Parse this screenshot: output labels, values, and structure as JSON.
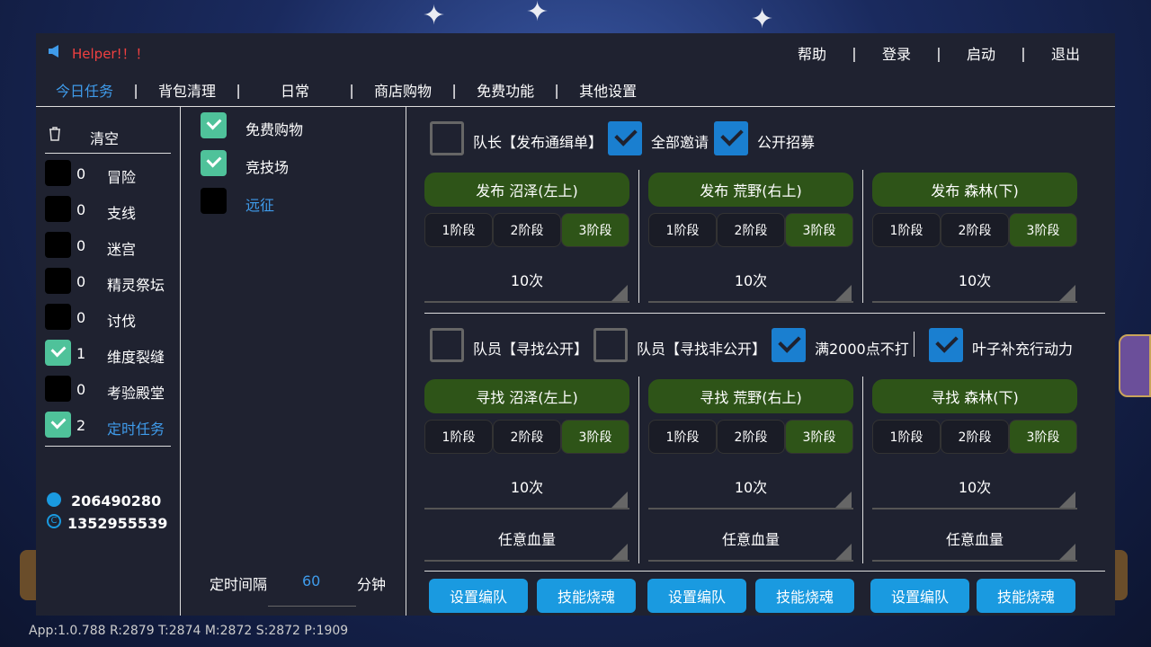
{
  "app": {
    "title": "Helper!！！"
  },
  "topmenu": [
    {
      "label": "帮助"
    },
    {
      "label": "登录"
    },
    {
      "label": "启动"
    },
    {
      "label": "退出"
    }
  ],
  "separator": "|",
  "tabs": [
    {
      "label": "今日任务",
      "active": true
    },
    {
      "label": "背包清理"
    },
    {
      "label": "日常"
    },
    {
      "label": "商店购物"
    },
    {
      "label": "免费功能"
    },
    {
      "label": "其他设置"
    }
  ],
  "left": {
    "clear_label": "清空",
    "items": [
      {
        "count": "0",
        "label": "冒险",
        "checked": false
      },
      {
        "count": "0",
        "label": "支线",
        "checked": false
      },
      {
        "count": "0",
        "label": "迷宫",
        "checked": false
      },
      {
        "count": "0",
        "label": "精灵祭坛",
        "checked": false
      },
      {
        "count": "0",
        "label": "讨伐",
        "checked": false
      },
      {
        "count": "1",
        "label": "维度裂缝",
        "checked": true
      },
      {
        "count": "0",
        "label": "考验殿堂",
        "checked": false
      },
      {
        "count": "2",
        "label": "定时任务",
        "checked": true,
        "highlight": true
      }
    ],
    "qq": "206490280",
    "copyright": "1352955539"
  },
  "middle": {
    "items": [
      {
        "label": "免费购物",
        "checked": true
      },
      {
        "label": "竞技场",
        "checked": true
      },
      {
        "label": "远征",
        "checked": false,
        "highlight": true
      }
    ],
    "interval_label": "定时间隔",
    "interval_value": "60",
    "interval_unit": "分钟"
  },
  "right": {
    "top_options": [
      {
        "label": "队长【发布通缉单】",
        "checked": false
      },
      {
        "label": "全部邀请",
        "checked": true
      },
      {
        "label": "公开招募",
        "checked": true
      }
    ],
    "publish": [
      {
        "title": "发布 沼泽(左上)",
        "stages": [
          "1阶段",
          "2阶段",
          "3阶段"
        ],
        "selected": "3阶段",
        "times": "10次"
      },
      {
        "title": "发布 荒野(右上)",
        "stages": [
          "1阶段",
          "2阶段",
          "3阶段"
        ],
        "selected": "3阶段",
        "times": "10次"
      },
      {
        "title": "发布 森林(下)",
        "stages": [
          "1阶段",
          "2阶段",
          "3阶段"
        ],
        "selected": "3阶段",
        "times": "10次"
      }
    ],
    "member_options": [
      {
        "label": "队员【寻找公开】",
        "checked": false
      },
      {
        "label": "队员【寻找非公开】",
        "checked": false
      },
      {
        "label": "满2000点不打",
        "checked": true
      },
      {
        "label": "叶子补充行动力",
        "checked": true
      }
    ],
    "find": [
      {
        "title": "寻找 沼泽(左上)",
        "stages": [
          "1阶段",
          "2阶段",
          "3阶段"
        ],
        "selected": "3阶段",
        "times": "10次",
        "hp": "任意血量"
      },
      {
        "title": "寻找 荒野(右上)",
        "stages": [
          "1阶段",
          "2阶段",
          "3阶段"
        ],
        "selected": "3阶段",
        "times": "10次",
        "hp": "任意血量"
      },
      {
        "title": "寻找 森林(下)",
        "stages": [
          "1阶段",
          "2阶段",
          "3阶段"
        ],
        "selected": "3阶段",
        "times": "10次",
        "hp": "任意血量"
      }
    ],
    "buttons": [
      {
        "setup": "设置编队",
        "skill": "技能烧魂"
      },
      {
        "setup": "设置编队",
        "skill": "技能烧魂"
      },
      {
        "setup": "设置编队",
        "skill": "技能烧魂"
      }
    ]
  },
  "statusbar": "App:1.0.788  R:2879 T:2874 M:2872 S:2872 P:1909",
  "colors": {
    "panel": "#1f2230",
    "accent": "#3f9bea",
    "check_green": "#4fc29a",
    "check_blue": "#1a7fd0",
    "stage_green": "#2e5418",
    "button_blue": "#1a9ae0",
    "title_red": "#f04040"
  }
}
